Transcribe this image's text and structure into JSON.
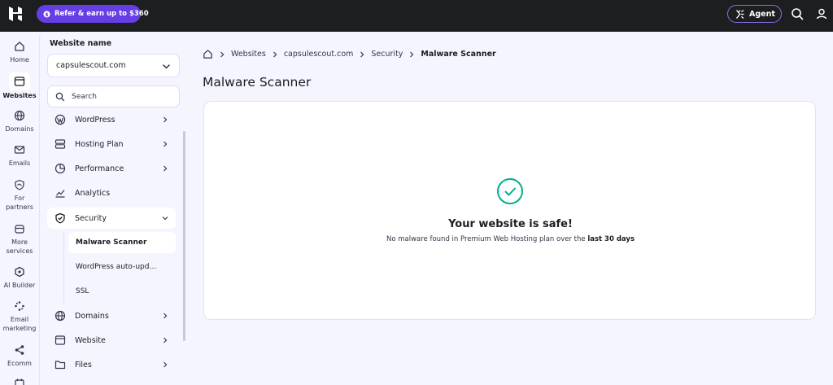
{
  "topbar": {
    "refer_label": "Refer & earn up to $360",
    "agent_label": "Agent"
  },
  "rail": [
    {
      "label": "Home",
      "icon": "home-icon"
    },
    {
      "label": "Websites",
      "icon": "browser-icon"
    },
    {
      "label": "Domains",
      "icon": "globe-icon"
    },
    {
      "label": "Emails",
      "icon": "mail-icon"
    },
    {
      "label": "For partners",
      "icon": "partner-shield-icon"
    },
    {
      "label": "More services",
      "icon": "store-icon"
    },
    {
      "label": "AI Builder",
      "icon": "ai-builder-icon"
    },
    {
      "label": "Email marketing",
      "icon": "email-marketing-icon"
    },
    {
      "label": "Ecomm",
      "icon": "ecomm-icon"
    }
  ],
  "sidebar": {
    "website_label": "Website name",
    "selected_site": "capsulescout.com",
    "search_placeholder": "Search",
    "items": [
      {
        "label": "WordPress"
      },
      {
        "label": "Hosting Plan"
      },
      {
        "label": "Performance"
      },
      {
        "label": "Analytics"
      },
      {
        "label": "Security"
      },
      {
        "label": "Domains"
      },
      {
        "label": "Website"
      },
      {
        "label": "Files"
      }
    ],
    "security_sub": [
      {
        "label": "Malware Scanner"
      },
      {
        "label": "WordPress auto-upd…"
      },
      {
        "label": "SSL"
      }
    ]
  },
  "breadcrumb": {
    "items": [
      "Websites",
      "capsulescout.com",
      "Security"
    ],
    "current": "Malware Scanner"
  },
  "main": {
    "title": "Malware Scanner",
    "status_title": "Your website is safe!",
    "status_desc": "No malware found in Premium Web Hosting plan over the",
    "status_period": "last 30 days"
  },
  "colors": {
    "topbar": "#1d1e20",
    "accent": "#673de6",
    "success": "#00b090",
    "background": "#f4f5ff"
  }
}
